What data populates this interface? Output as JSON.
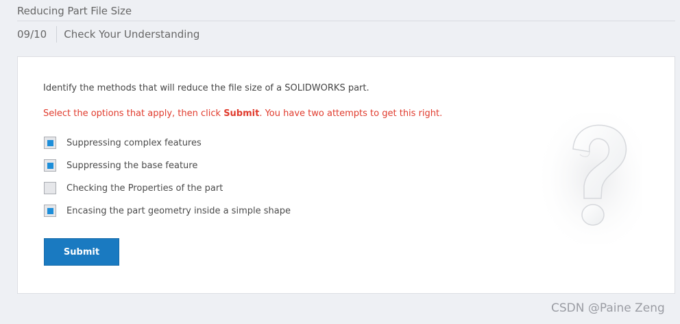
{
  "header": {
    "course_title": "Reducing Part File Size",
    "step_counter": "09/10",
    "step_title": "Check Your Understanding"
  },
  "quiz": {
    "question": "Identify the methods that will reduce the file size of a SOLIDWORKS part.",
    "instruction_before": "Select the options that apply, then click ",
    "instruction_emphasis": "Submit",
    "instruction_after": ". You have two attempts to get this right.",
    "options": [
      {
        "label": "Suppressing complex features",
        "checked": true
      },
      {
        "label": "Suppressing the base feature",
        "checked": true
      },
      {
        "label": "Checking the Properties of the part",
        "checked": false
      },
      {
        "label": "Encasing the part geometry inside a simple shape",
        "checked": true
      }
    ],
    "submit_label": "Submit",
    "decoration_icon": "question-mark-icon"
  },
  "watermark": "CSDN @Paine Zeng",
  "colors": {
    "accent": "#1a7ac1",
    "check_fill": "#1d8ed9",
    "instruction": "#e03a2c",
    "page_background": "#eef0f4"
  }
}
